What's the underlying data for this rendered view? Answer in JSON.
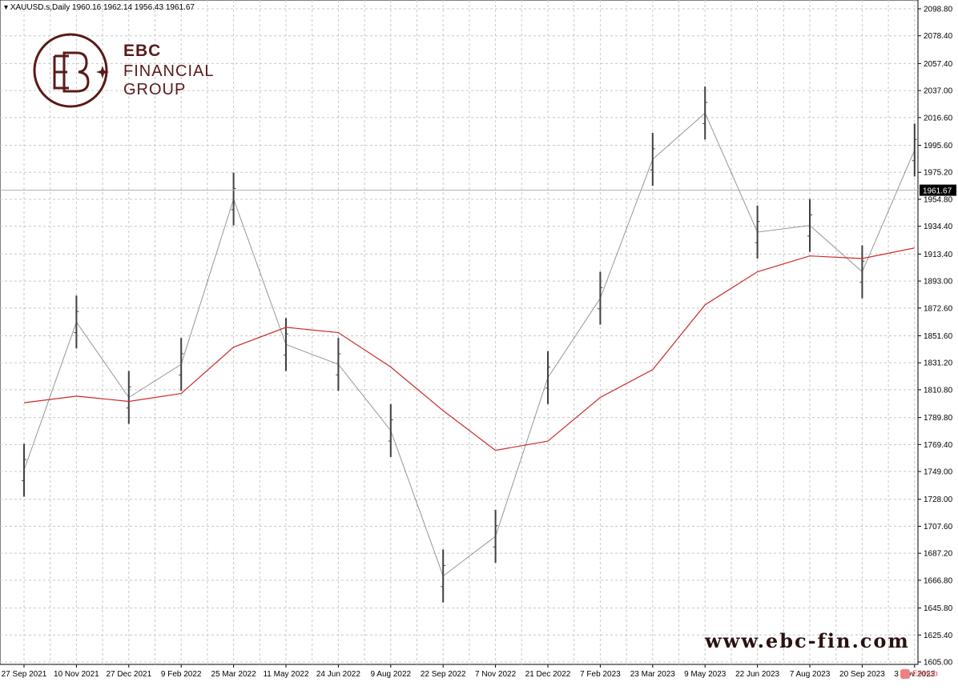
{
  "header": {
    "symbol_line": "XAUUSD.s,Daily  1960.16 1962.14 1956.43 1961.67",
    "collapse_icon": "triangle-down-icon"
  },
  "logo": {
    "line1": "EBC",
    "line2": "FINANCIAL",
    "line3": "GROUP",
    "mark_icon": "ebc-monogram-icon",
    "color": "#5a1a1a"
  },
  "watermark": {
    "website": "www.ebc-fin.com",
    "badge": "EAHub"
  },
  "colors": {
    "candle": "#404040",
    "ma": "#cc2b2b",
    "grid": "#c8c8c8",
    "price_line": "#b0b0b0"
  },
  "chart_data": {
    "type": "line",
    "symbol": "XAUUSD.s",
    "timeframe": "Daily",
    "ohlc_last": {
      "open": 1960.16,
      "high": 1962.14,
      "low": 1956.43,
      "close": 1961.67
    },
    "current_price_label": "1961.67",
    "y_ticks": [
      "2098.80",
      "2078.40",
      "2057.40",
      "2037.00",
      "2016.60",
      "1995.60",
      "1975.20",
      "1954.80",
      "1934.40",
      "1913.40",
      "1893.00",
      "1872.60",
      "1851.60",
      "1831.20",
      "1810.80",
      "1789.80",
      "1769.40",
      "1749.00",
      "1728.00",
      "1707.60",
      "1687.20",
      "1666.80",
      "1645.80",
      "1625.40",
      "1605.00"
    ],
    "x_ticks": [
      "27 Sep 2021",
      "10 Nov 2021",
      "27 Dec 2021",
      "9 Feb 2022",
      "25 Mar 2022",
      "11 May 2022",
      "24 Jun 2022",
      "9 Aug 2022",
      "22 Sep 2022",
      "7 Nov 2022",
      "21 Dec 2022",
      "7 Feb 2023",
      "23 Mar 2023",
      "9 May 2023",
      "22 Jun 2023",
      "7 Aug 2023",
      "20 Sep 2023",
      "3 Nov 2023"
    ],
    "ylim": [
      1605.0,
      2098.8
    ],
    "grid": true,
    "series": [
      {
        "style": "bars",
        "x": [
          "27 Sep 2021",
          "10 Nov 2021",
          "27 Dec 2021",
          "9 Feb 2022",
          "25 Mar 2022",
          "11 May 2022",
          "24 Jun 2022",
          "9 Aug 2022",
          "22 Sep 2022",
          "7 Nov 2022",
          "21 Dec 2022",
          "7 Feb 2023",
          "23 Mar 2023",
          "9 May 2023",
          "22 Jun 2023",
          "7 Aug 2023",
          "20 Sep 2023",
          "3 Nov 2023"
        ],
        "values": [
          1750,
          1862,
          1805,
          1830,
          1955,
          1845,
          1830,
          1780,
          1670,
          1700,
          1820,
          1880,
          1985,
          2020,
          1930,
          1935,
          1900,
          1992
        ]
      },
      {
        "style": "line",
        "x": [
          "27 Sep 2021",
          "10 Nov 2021",
          "27 Dec 2021",
          "9 Feb 2022",
          "25 Mar 2022",
          "11 May 2022",
          "24 Jun 2022",
          "9 Aug 2022",
          "22 Sep 2022",
          "7 Nov 2022",
          "21 Dec 2022",
          "7 Feb 2023",
          "23 Mar 2023",
          "9 May 2023",
          "22 Jun 2023",
          "7 Aug 2023",
          "20 Sep 2023",
          "3 Nov 2023"
        ],
        "values": [
          1801,
          1806,
          1802,
          1808,
          1843,
          1858,
          1854,
          1828,
          1795,
          1765,
          1772,
          1805,
          1826,
          1875,
          1900,
          1912,
          1910,
          1918
        ]
      }
    ]
  }
}
